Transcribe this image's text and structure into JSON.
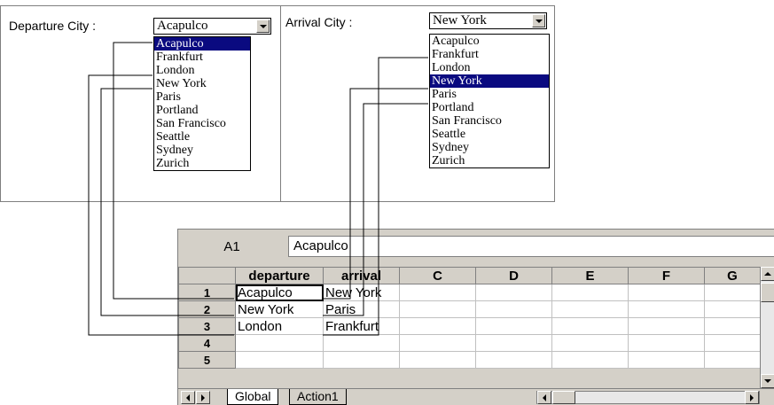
{
  "departure": {
    "label": "Departure City :",
    "value": "Acapulco",
    "options": [
      "Acapulco",
      "Frankfurt",
      "London",
      "New York",
      "Paris",
      "Portland",
      "San Francisco",
      "Seattle",
      "Sydney",
      "Zurich"
    ],
    "selected_index": 0
  },
  "arrival": {
    "label": "Arrival City :",
    "value": "New York",
    "options": [
      "Acapulco",
      "Frankfurt",
      "London",
      "New York",
      "Paris",
      "Portland",
      "San Francisco",
      "Seattle",
      "Sydney",
      "Zurich"
    ],
    "selected_index": 3
  },
  "sheet": {
    "name_box": "A1",
    "formula_value": "Acapulco",
    "columns": [
      "departure",
      "arrival",
      "C",
      "D",
      "E",
      "F",
      "G"
    ],
    "rows": [
      {
        "num": "1",
        "cells": [
          "Acapulco",
          "New York",
          "",
          "",
          "",
          "",
          ""
        ]
      },
      {
        "num": "2",
        "cells": [
          "New York",
          "Paris",
          "",
          "",
          "",
          "",
          ""
        ]
      },
      {
        "num": "3",
        "cells": [
          "London",
          "Frankfurt",
          "",
          "",
          "",
          "",
          ""
        ]
      },
      {
        "num": "4",
        "cells": [
          "",
          "",
          "",
          "",
          "",
          "",
          ""
        ]
      },
      {
        "num": "5",
        "cells": [
          "",
          "",
          "",
          "",
          "",
          "",
          ""
        ]
      }
    ],
    "tabs": [
      "Global",
      "Action1"
    ]
  },
  "colors": {
    "selection": "#0a0a80",
    "chrome": "#d4d0c8"
  }
}
